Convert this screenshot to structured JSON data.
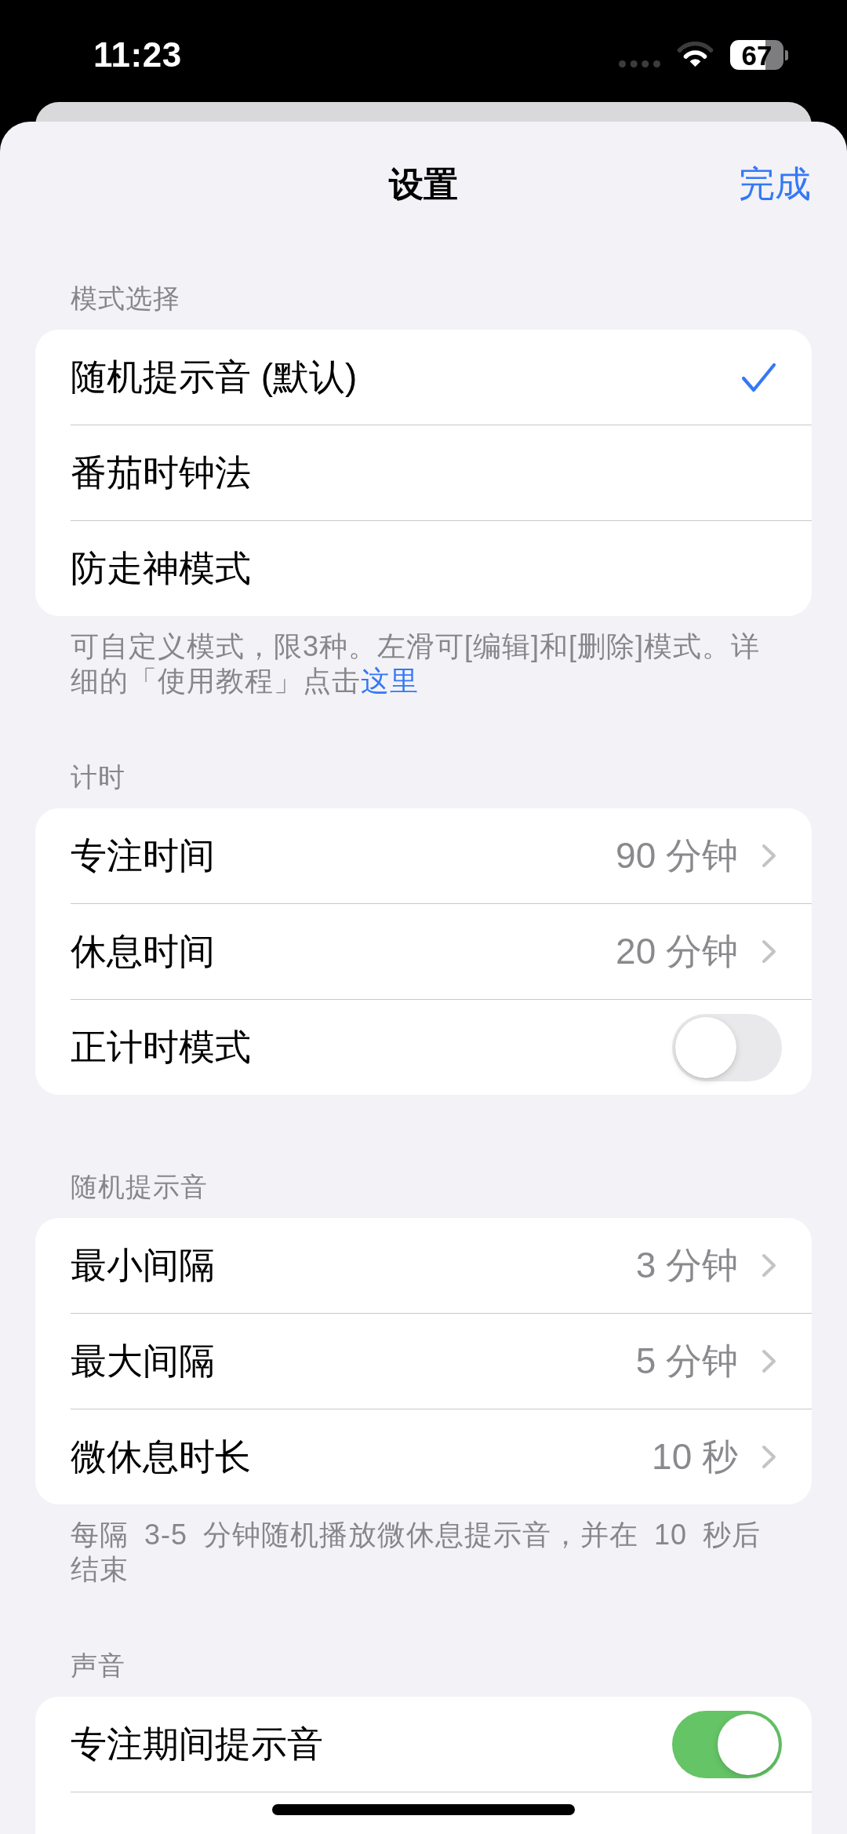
{
  "status_bar": {
    "time": "11:23",
    "battery": "67"
  },
  "nav": {
    "title": "设置",
    "done": "完成"
  },
  "sections": [
    {
      "header": "模式选择",
      "rows": [
        {
          "kind": "choice",
          "label": "随机提示音 (默认)",
          "selected": true
        },
        {
          "kind": "choice",
          "label": "番茄时钟法",
          "selected": false
        },
        {
          "kind": "choice",
          "label": "防走神模式",
          "selected": false
        }
      ],
      "footer": {
        "text": "可自定义模式，限3种。左滑可[编辑]和[删除]模式。详细的「使用教程」点击",
        "link": "这里"
      }
    },
    {
      "header": "计时",
      "rows": [
        {
          "kind": "value",
          "label": "专注时间",
          "value": "90 分钟"
        },
        {
          "kind": "value",
          "label": "休息时间",
          "value": "20 分钟"
        },
        {
          "kind": "toggle",
          "label": "正计时模式",
          "on": false
        }
      ]
    },
    {
      "header": "随机提示音",
      "rows": [
        {
          "kind": "value",
          "label": "最小间隔",
          "value": "3 分钟"
        },
        {
          "kind": "value",
          "label": "最大间隔",
          "value": "5 分钟"
        },
        {
          "kind": "value",
          "label": "微休息时长",
          "value": "10 秒"
        }
      ],
      "footer": {
        "text": "每隔 3-5 分钟随机播放微休息提示音，并在 10 秒后结束"
      }
    },
    {
      "header": "声音",
      "rows": [
        {
          "kind": "toggle",
          "label": "专注期间提示音",
          "on": true
        }
      ]
    }
  ]
}
